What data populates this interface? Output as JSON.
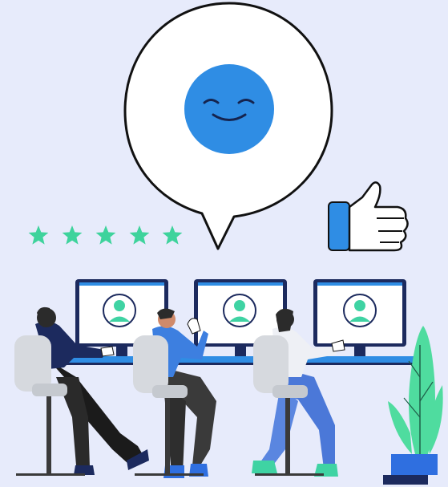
{
  "scene": {
    "kind": "illustration",
    "subject": "customer-satisfaction",
    "rating": {
      "value": 5,
      "max": 5
    },
    "icons": [
      "smiley-face-icon",
      "thumbs-up-icon",
      "star-icon",
      "user-avatar-icon"
    ],
    "workstations": 3,
    "people": 3,
    "colors": {
      "background": "#e7ebfb",
      "accent_blue": "#2f8de4",
      "star_green": "#3ed39c",
      "avatar_green": "#3fd3a3",
      "navy": "#1c2a5e",
      "plant_green": "#4fdc9f",
      "chair_gray": "#d6d9de"
    }
  }
}
